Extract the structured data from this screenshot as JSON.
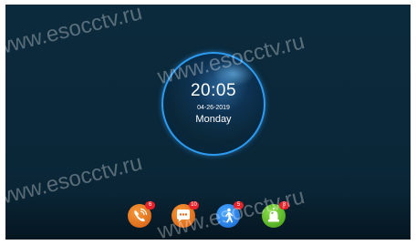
{
  "clock": {
    "time": "20:05",
    "date": "04-26-2019",
    "weekday": "Monday"
  },
  "dock": {
    "apps": [
      {
        "name": "calls",
        "icon": "phone-icon",
        "badge": "6",
        "color": "#e56a16"
      },
      {
        "name": "messages",
        "icon": "chat-icon",
        "badge": "10",
        "color": "#e56a16"
      },
      {
        "name": "visitors",
        "icon": "walking-person-icon",
        "badge": "5",
        "color": "#1f7ee0"
      },
      {
        "name": "alarm",
        "icon": "alarm-light-icon",
        "badge": "8",
        "color": "#4fae1e"
      }
    ]
  },
  "watermarks": [
    "www.esocctv.ru",
    "www.esocctv.ru",
    "www.esocctv.ru",
    "www.esocctv.ru"
  ],
  "colors": {
    "background": "#0b2a3c",
    "clock_ring": "#2d9bf0",
    "badge": "#e6222b"
  }
}
